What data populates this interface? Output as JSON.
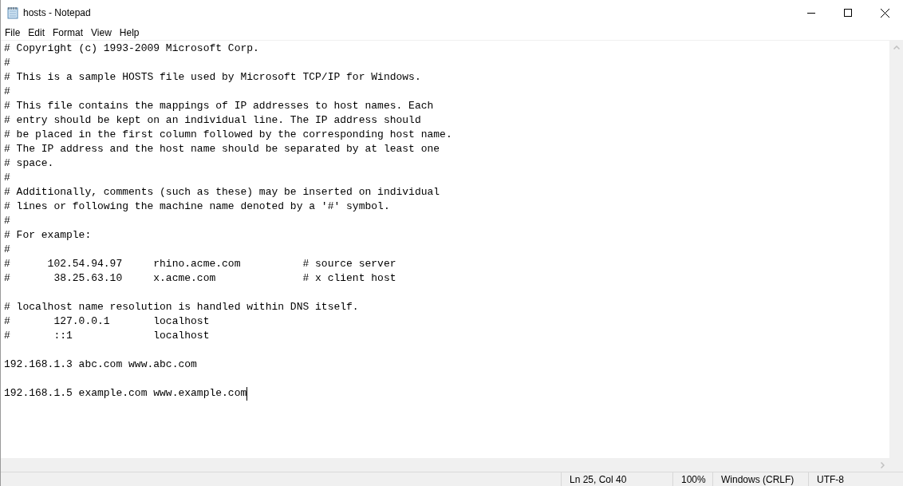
{
  "window": {
    "title": "hosts - Notepad"
  },
  "menu": [
    "File",
    "Edit",
    "Format",
    "View",
    "Help"
  ],
  "blocks": [
    [
      "# Copyright (c) 1993-2009 Microsoft Corp.",
      "#",
      "# This is a sample HOSTS file used by Microsoft TCP/IP for Windows.",
      "#",
      "# This file contains the mappings of IP addresses to host names. Each",
      "# entry should be kept on an individual line. The IP address should",
      "# be placed in the first column followed by the corresponding host name.",
      "# The IP address and the host name should be separated by at least one",
      "# space.",
      "#",
      "# Additionally, comments (such as these) may be inserted on individual",
      "# lines or following the machine name denoted by a '#' symbol.",
      "#",
      "# For example:",
      "#",
      "#      102.54.94.97     rhino.acme.com          # source server",
      "#       38.25.63.10     x.acme.com              # x client host"
    ],
    [
      "# localhost name resolution is handled within DNS itself.",
      "#       127.0.0.1       localhost",
      "#       ::1             localhost"
    ],
    [
      "192.168.1.3 abc.com www.abc.com"
    ],
    [
      "192.168.1.5 example.com www.example.com"
    ]
  ],
  "status_bar": [
    "Ln 25, Col 40",
    "100%",
    "Windows (CRLF)",
    "UTF-8"
  ]
}
